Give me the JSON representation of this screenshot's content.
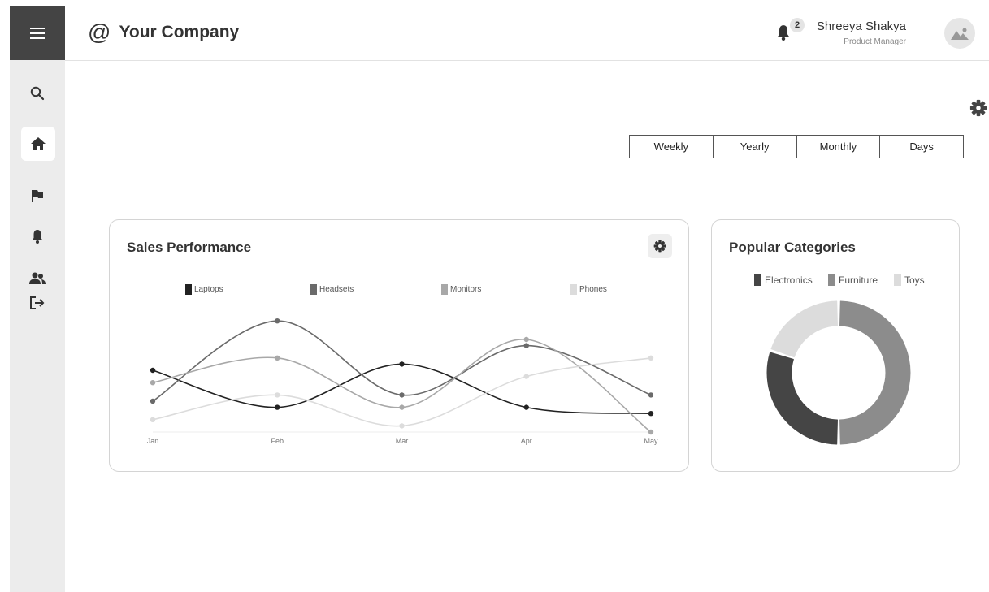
{
  "brand": {
    "symbol": "@",
    "name": "Your Company"
  },
  "header": {
    "notification_count": "2",
    "user_name": "Shreeya Shakya",
    "user_role": "Product Manager"
  },
  "sidebar": {
    "items": [
      {
        "icon": "search-icon"
      },
      {
        "icon": "home-icon",
        "active": true
      },
      {
        "icon": "flag-icon"
      },
      {
        "icon": "bell-icon"
      },
      {
        "icon": "users-icon"
      },
      {
        "icon": "logout-icon"
      }
    ]
  },
  "period_tabs": [
    "Weekly",
    "Yearly",
    "Monthly",
    "Days"
  ],
  "sales_card": {
    "title": "Sales Performance",
    "legend": [
      "Laptops",
      "Headsets",
      "Monitors",
      "Phones"
    ]
  },
  "categories_card": {
    "title": "Popular Categories",
    "legend": [
      "Electronics",
      "Furniture",
      "Toys"
    ]
  },
  "colors": {
    "laptops": "#222222",
    "headsets": "#6a6a6a",
    "monitors": "#a8a8a8",
    "phones": "#dcdcdc",
    "electronics": "#454545",
    "furniture": "#8c8c8c",
    "toys": "#dcdcdc",
    "sidebar_bg": "#ececec",
    "menu_bg": "#444444"
  },
  "chart_data": [
    {
      "type": "line",
      "title": "Sales Performance",
      "x": [
        "Jan",
        "Feb",
        "Mar",
        "Apr",
        "May"
      ],
      "ylim": [
        0,
        10
      ],
      "grid": false,
      "legend_position": "top",
      "series": [
        {
          "name": "Laptops",
          "values": [
            5,
            2,
            5.5,
            2,
            1.5
          ]
        },
        {
          "name": "Headsets",
          "values": [
            2.5,
            9,
            3,
            7,
            3
          ]
        },
        {
          "name": "Monitors",
          "values": [
            4,
            6,
            2,
            7.5,
            0
          ]
        },
        {
          "name": "Phones",
          "values": [
            1,
            3,
            0.5,
            4.5,
            6
          ]
        }
      ]
    },
    {
      "type": "pie",
      "title": "Popular Categories",
      "legend_position": "top",
      "categories": [
        "Electronics",
        "Furniture",
        "Toys"
      ],
      "values": [
        30,
        50,
        20
      ]
    }
  ]
}
